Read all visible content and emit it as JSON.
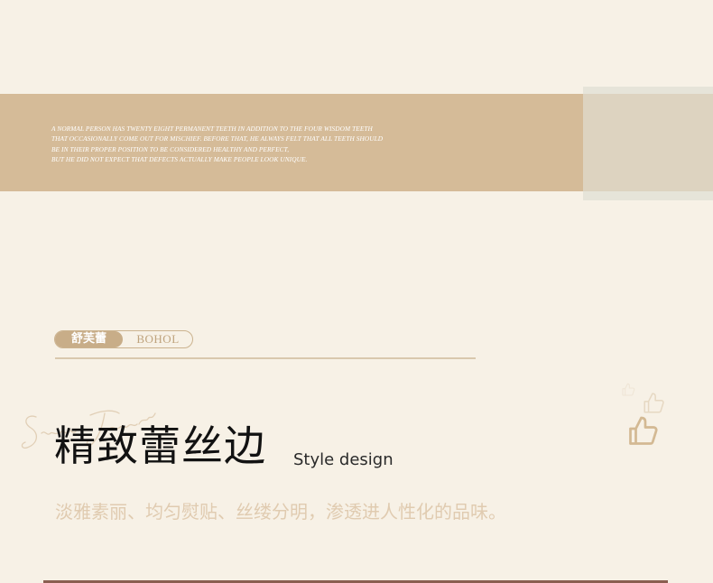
{
  "banner": {
    "lines": [
      "A NORMAL PERSON HAS TWENTY EIGHT PERMANENT TEETH IN ADDITION TO THE FOUR WISDOM TEETH",
      "THAT OCCASIONALLY COME OUT FOR MISCHIEF. BEFORE THAT, HE ALWAYS FELT THAT ALL TEETH SHOULD",
      "BE IN THEIR PROPER POSITION TO BE CONSIDERED HEALTHY AND PERFECT,",
      "BUT HE DID NOT EXPECT THAT DEFECTS ACTUALLY MAKE PEOPLE LOOK UNIQUE."
    ]
  },
  "badge": {
    "left_label": "舒芙蕾",
    "right_label": "BOHOL"
  },
  "section": {
    "title": "精致蕾丝边",
    "subtitle": "Style design",
    "description": "淡雅素丽、均匀熨贴、丝缕分明，渗透进人性化的品味。"
  },
  "icons": {
    "thumbs_up": "thumbs-up-icon",
    "script_decoration": "script-signature"
  },
  "colors": {
    "background": "#f7f1e6",
    "banner": "#d5bb98",
    "accent": "#c8ad88",
    "description": "#e0cbb0"
  }
}
